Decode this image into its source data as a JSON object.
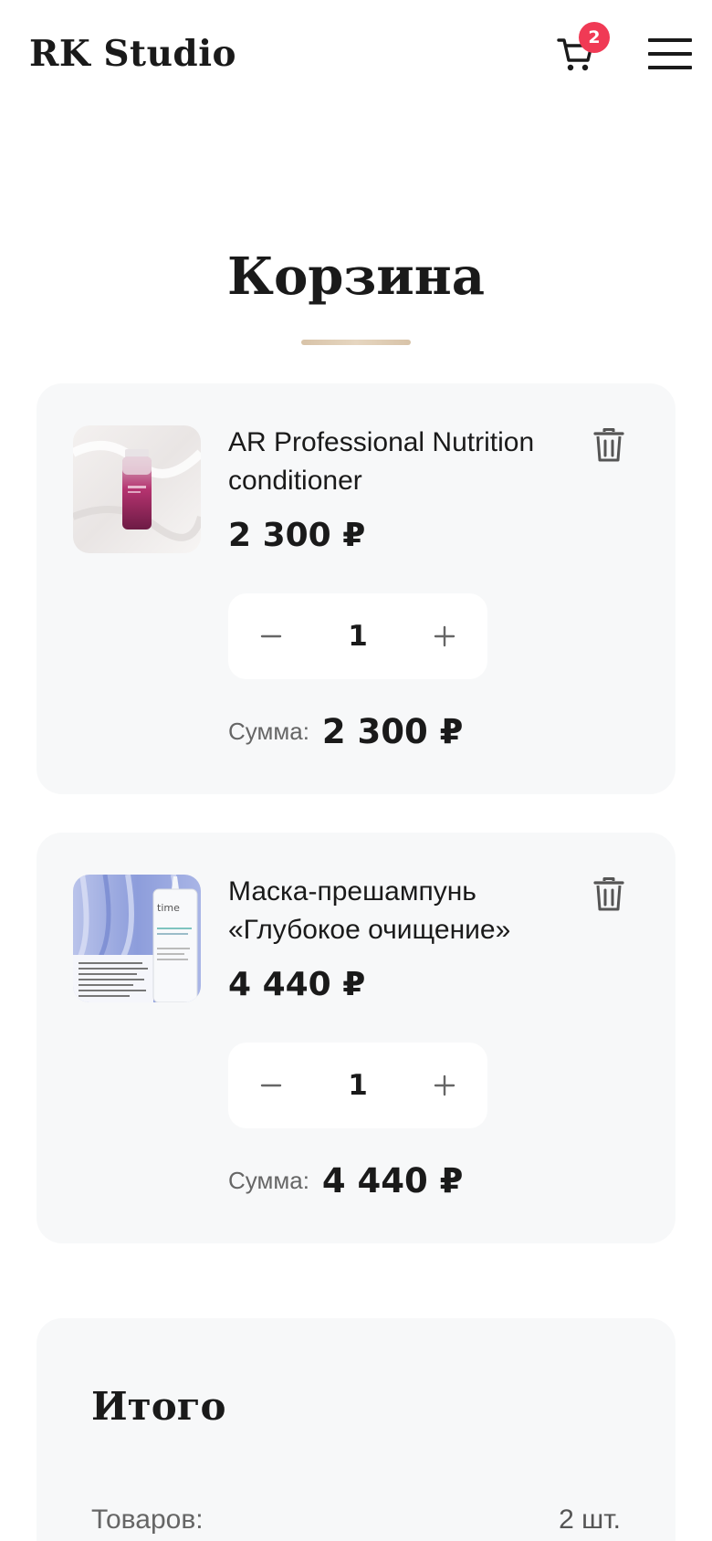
{
  "header": {
    "logo": "RK Studio",
    "cart_count": "2"
  },
  "page": {
    "title": "Корзина"
  },
  "cart": {
    "items": [
      {
        "name": "AR Professional Nutrition conditioner",
        "price": "2 300 ₽",
        "quantity": "1",
        "sum_label": "Сумма:",
        "sum_value": "2 300 ₽"
      },
      {
        "name": "Маска-прешампунь «Глубокое очищение»",
        "price": "4 440 ₽",
        "quantity": "1",
        "sum_label": "Сумма:",
        "sum_value": "4 440 ₽"
      }
    ]
  },
  "summary": {
    "title": "Итого",
    "items_label": "Товаров:",
    "items_value": "2 шт."
  },
  "colors": {
    "badge": "#f03a55",
    "accent_underline": "#d8c3a8",
    "card_bg": "#f7f8f9"
  },
  "icons": {
    "cart": "cart-icon",
    "menu": "hamburger-menu-icon",
    "delete": "trash-icon",
    "decrease": "minus-icon",
    "increase": "plus-icon"
  }
}
